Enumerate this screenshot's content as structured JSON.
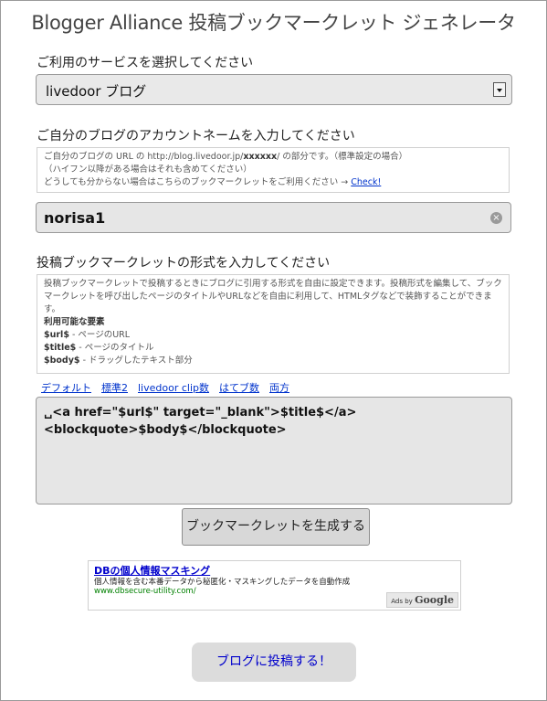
{
  "header": {
    "title": "Blogger Alliance 投稿ブックマークレット ジェネレータ"
  },
  "service": {
    "heading": "ご利用のサービスを選択してください",
    "selected": "livedoor ブログ"
  },
  "account": {
    "heading": "ご自分のブログのアカウントネームを入力してください",
    "help_line1_a": "ご自分のブログの URL の http://blog.livedoor.jp/",
    "help_line1_b": "xxxxxx",
    "help_line1_c": "/ の部分です。（標準設定の場合）",
    "help_line2": "（ハイフン以降がある場合はそれも含めてください）",
    "help_line3": "どうしても分からない場合はこちらのブックマークレットをご利用ください →",
    "help_link": "Check!",
    "value": "norisa1"
  },
  "format": {
    "heading": "投稿ブックマークレットの形式を入力してください",
    "desc_line1": "投稿ブックマークレットで投稿するときにブログに引用する形式を自由に設定できます。投稿形式を編集して、ブック",
    "desc_line2": "マークレットを呼び出したページのタイトルやURLなどを自由に利用して、HTMLタグなどで装飾することができま",
    "desc_line3": "す。",
    "elements_title": "利用可能な要素",
    "el1_key": "$url$",
    "el1_desc": " - ページのURL",
    "el2_key": "$title$",
    "el2_desc": " - ページのタイトル",
    "el3_key": "$body$",
    "el3_desc": " - ドラッグしたテキスト部分",
    "presets": [
      "デフォルト",
      "標準2",
      "livedoor clip数",
      "はてブ数",
      "両方"
    ],
    "template_line1": "␣<a href=\"$url$\" target=\"_blank\">$title$</a>",
    "template_line2": "<blockquote>$body$</blockquote>"
  },
  "generate_button": "ブックマークレットを生成する",
  "ad": {
    "title": "DBの個人情報マスキング",
    "desc": "個人情報を含む本番データから秘匿化・マスキングしたデータを自動作成",
    "url": "www.dbsecure-utility.com/",
    "ads_by": "Ads by",
    "google": "Google"
  },
  "post_button": "ブログに投稿する！"
}
